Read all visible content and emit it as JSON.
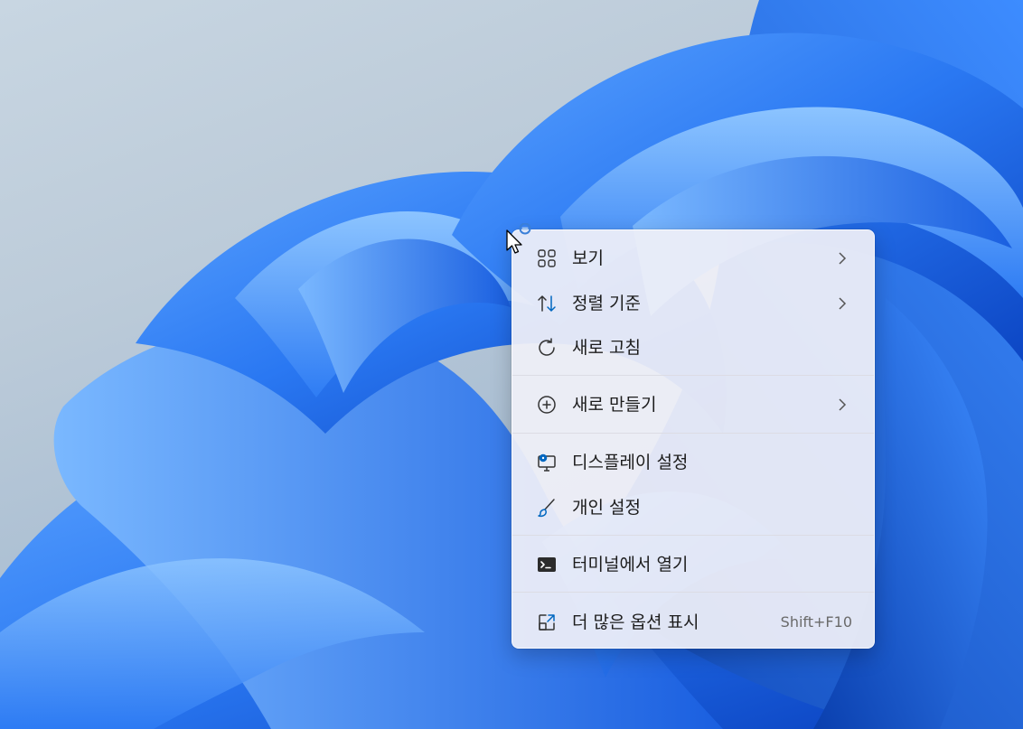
{
  "context_menu": {
    "items": [
      {
        "label": "보기",
        "icon": "grid-view-icon",
        "has_submenu": true
      },
      {
        "label": "정렬 기준",
        "icon": "sort-arrows-icon",
        "has_submenu": true
      },
      {
        "label": "새로 고침",
        "icon": "refresh-icon",
        "has_submenu": false
      },
      {
        "label": "새로 만들기",
        "icon": "plus-circle-icon",
        "has_submenu": true
      },
      {
        "label": "디스플레이 설정",
        "icon": "display-settings-icon",
        "has_submenu": false
      },
      {
        "label": "개인 설정",
        "icon": "brush-icon",
        "has_submenu": false
      },
      {
        "label": "터미널에서 열기",
        "icon": "terminal-icon",
        "has_submenu": false
      },
      {
        "label": "더 많은 옵션 표시",
        "icon": "open-external-icon",
        "has_submenu": false,
        "shortcut": "Shift+F10"
      }
    ]
  },
  "colors": {
    "accent": "#0067c0",
    "menu_background": "#f0f0f8",
    "wallpaper_blue": "#1f6ff0"
  }
}
